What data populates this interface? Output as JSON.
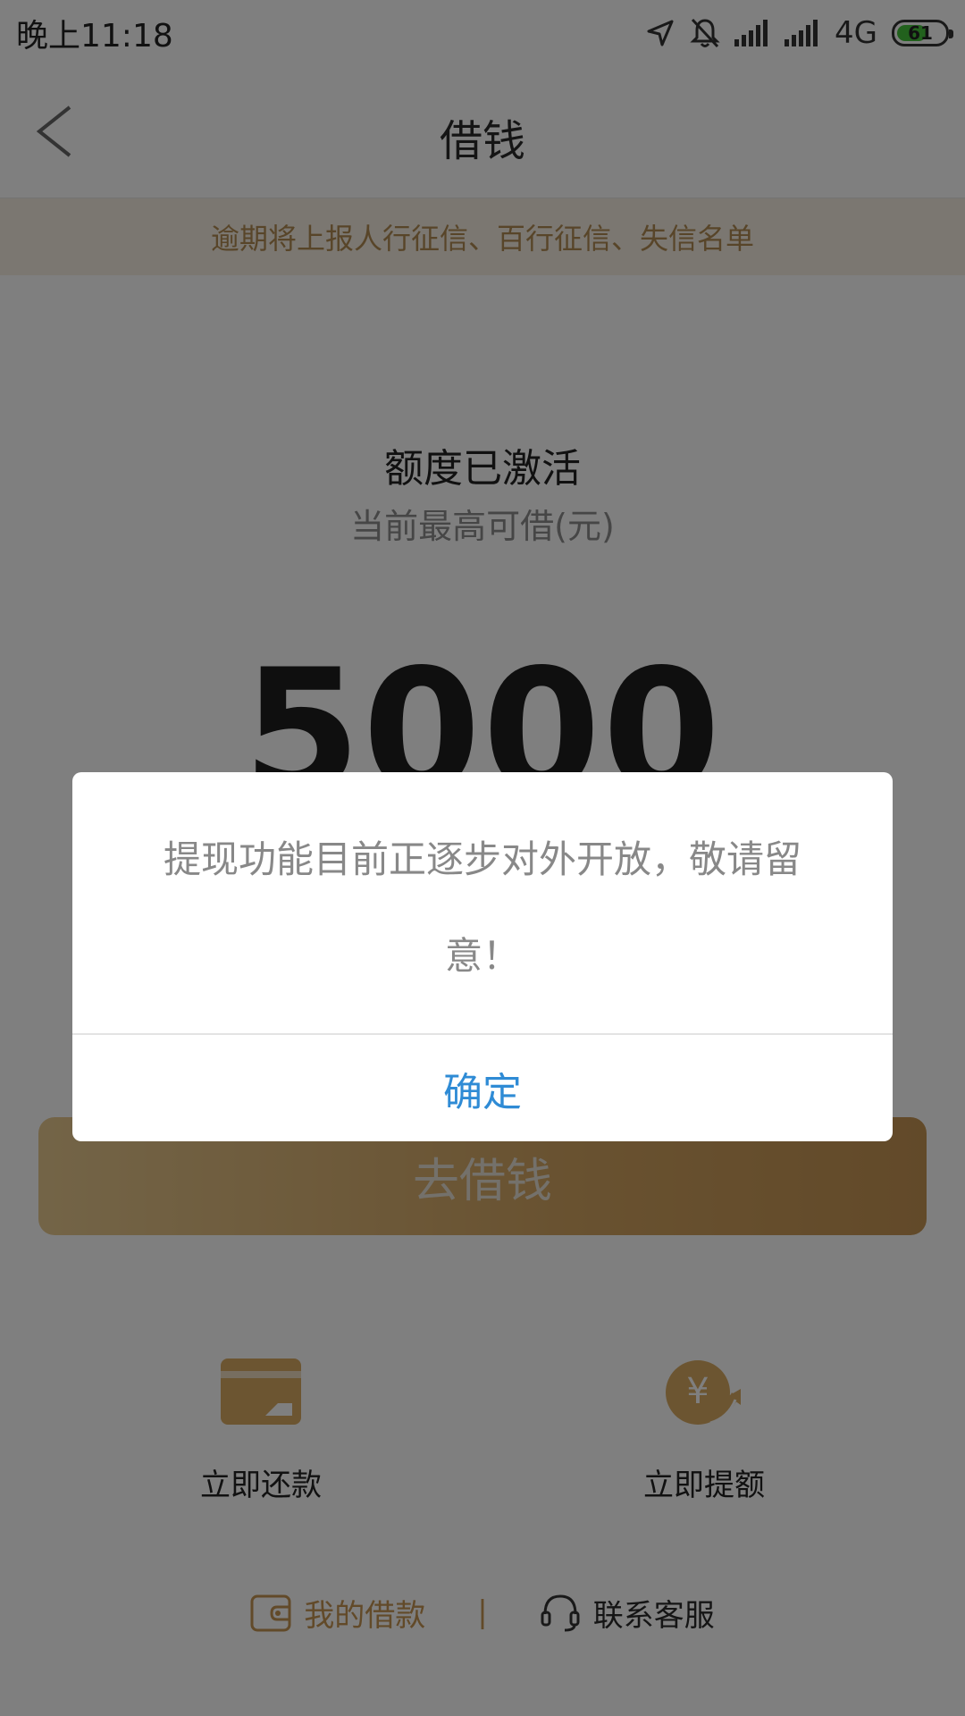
{
  "status_bar": {
    "time": "晚上11:18",
    "network": "4G",
    "battery": "61",
    "battery_level": 0.61
  },
  "header": {
    "title": "借钱",
    "back_icon": "chevron-left-icon"
  },
  "notice": {
    "text": "逾期将上报人行征信、百行征信、失信名单"
  },
  "quota": {
    "title": "额度已激活",
    "subtitle": "当前最高可借(元)",
    "amount": "5000"
  },
  "borrow_button": {
    "label": "去借钱"
  },
  "actions": [
    {
      "label": "立即还款",
      "icon": "card-icon"
    },
    {
      "label": "立即提额",
      "icon": "yuan-coin-icon"
    }
  ],
  "bottom_links": {
    "my_loans": "我的借款",
    "separator": "|",
    "customer_service": "联系客服"
  },
  "dialog": {
    "message": "提现功能目前正逐步对外开放，敬请留意！",
    "confirm": "确定"
  },
  "colors": {
    "accent_gold": "#c59453",
    "notice_bg": "#f6efe2",
    "confirm_blue": "#2f8bd5",
    "battery_green": "#45c23a"
  }
}
